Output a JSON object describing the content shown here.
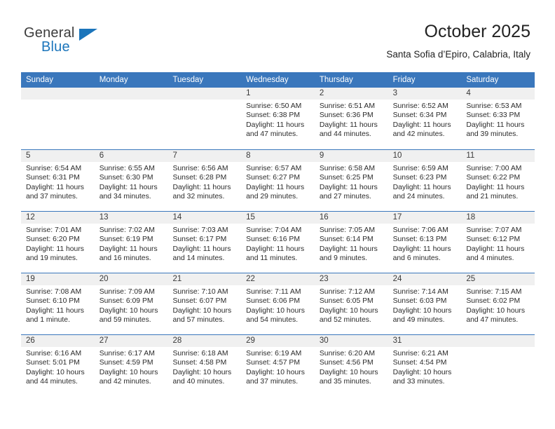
{
  "brand": {
    "name_part1": "General",
    "name_part2": "Blue"
  },
  "header": {
    "title": "October 2025",
    "subtitle": "Santa Sofia d’Epiro, Calabria, Italy"
  },
  "weekdays": [
    "Sunday",
    "Monday",
    "Tuesday",
    "Wednesday",
    "Thursday",
    "Friday",
    "Saturday"
  ],
  "colors": {
    "header_blue": "#3a77bc",
    "brand_blue": "#1b75bb",
    "daynum_band": "#f0f0f0",
    "text": "#2b2b2b"
  },
  "weeks": [
    [
      {
        "day": "",
        "lines": []
      },
      {
        "day": "",
        "lines": []
      },
      {
        "day": "",
        "lines": []
      },
      {
        "day": "1",
        "lines": [
          "Sunrise: 6:50 AM",
          "Sunset: 6:38 PM",
          "Daylight: 11 hours",
          "and 47 minutes."
        ]
      },
      {
        "day": "2",
        "lines": [
          "Sunrise: 6:51 AM",
          "Sunset: 6:36 PM",
          "Daylight: 11 hours",
          "and 44 minutes."
        ]
      },
      {
        "day": "3",
        "lines": [
          "Sunrise: 6:52 AM",
          "Sunset: 6:34 PM",
          "Daylight: 11 hours",
          "and 42 minutes."
        ]
      },
      {
        "day": "4",
        "lines": [
          "Sunrise: 6:53 AM",
          "Sunset: 6:33 PM",
          "Daylight: 11 hours",
          "and 39 minutes."
        ]
      }
    ],
    [
      {
        "day": "5",
        "lines": [
          "Sunrise: 6:54 AM",
          "Sunset: 6:31 PM",
          "Daylight: 11 hours",
          "and 37 minutes."
        ]
      },
      {
        "day": "6",
        "lines": [
          "Sunrise: 6:55 AM",
          "Sunset: 6:30 PM",
          "Daylight: 11 hours",
          "and 34 minutes."
        ]
      },
      {
        "day": "7",
        "lines": [
          "Sunrise: 6:56 AM",
          "Sunset: 6:28 PM",
          "Daylight: 11 hours",
          "and 32 minutes."
        ]
      },
      {
        "day": "8",
        "lines": [
          "Sunrise: 6:57 AM",
          "Sunset: 6:27 PM",
          "Daylight: 11 hours",
          "and 29 minutes."
        ]
      },
      {
        "day": "9",
        "lines": [
          "Sunrise: 6:58 AM",
          "Sunset: 6:25 PM",
          "Daylight: 11 hours",
          "and 27 minutes."
        ]
      },
      {
        "day": "10",
        "lines": [
          "Sunrise: 6:59 AM",
          "Sunset: 6:23 PM",
          "Daylight: 11 hours",
          "and 24 minutes."
        ]
      },
      {
        "day": "11",
        "lines": [
          "Sunrise: 7:00 AM",
          "Sunset: 6:22 PM",
          "Daylight: 11 hours",
          "and 21 minutes."
        ]
      }
    ],
    [
      {
        "day": "12",
        "lines": [
          "Sunrise: 7:01 AM",
          "Sunset: 6:20 PM",
          "Daylight: 11 hours",
          "and 19 minutes."
        ]
      },
      {
        "day": "13",
        "lines": [
          "Sunrise: 7:02 AM",
          "Sunset: 6:19 PM",
          "Daylight: 11 hours",
          "and 16 minutes."
        ]
      },
      {
        "day": "14",
        "lines": [
          "Sunrise: 7:03 AM",
          "Sunset: 6:17 PM",
          "Daylight: 11 hours",
          "and 14 minutes."
        ]
      },
      {
        "day": "15",
        "lines": [
          "Sunrise: 7:04 AM",
          "Sunset: 6:16 PM",
          "Daylight: 11 hours",
          "and 11 minutes."
        ]
      },
      {
        "day": "16",
        "lines": [
          "Sunrise: 7:05 AM",
          "Sunset: 6:14 PM",
          "Daylight: 11 hours",
          "and 9 minutes."
        ]
      },
      {
        "day": "17",
        "lines": [
          "Sunrise: 7:06 AM",
          "Sunset: 6:13 PM",
          "Daylight: 11 hours",
          "and 6 minutes."
        ]
      },
      {
        "day": "18",
        "lines": [
          "Sunrise: 7:07 AM",
          "Sunset: 6:12 PM",
          "Daylight: 11 hours",
          "and 4 minutes."
        ]
      }
    ],
    [
      {
        "day": "19",
        "lines": [
          "Sunrise: 7:08 AM",
          "Sunset: 6:10 PM",
          "Daylight: 11 hours",
          "and 1 minute."
        ]
      },
      {
        "day": "20",
        "lines": [
          "Sunrise: 7:09 AM",
          "Sunset: 6:09 PM",
          "Daylight: 10 hours",
          "and 59 minutes."
        ]
      },
      {
        "day": "21",
        "lines": [
          "Sunrise: 7:10 AM",
          "Sunset: 6:07 PM",
          "Daylight: 10 hours",
          "and 57 minutes."
        ]
      },
      {
        "day": "22",
        "lines": [
          "Sunrise: 7:11 AM",
          "Sunset: 6:06 PM",
          "Daylight: 10 hours",
          "and 54 minutes."
        ]
      },
      {
        "day": "23",
        "lines": [
          "Sunrise: 7:12 AM",
          "Sunset: 6:05 PM",
          "Daylight: 10 hours",
          "and 52 minutes."
        ]
      },
      {
        "day": "24",
        "lines": [
          "Sunrise: 7:14 AM",
          "Sunset: 6:03 PM",
          "Daylight: 10 hours",
          "and 49 minutes."
        ]
      },
      {
        "day": "25",
        "lines": [
          "Sunrise: 7:15 AM",
          "Sunset: 6:02 PM",
          "Daylight: 10 hours",
          "and 47 minutes."
        ]
      }
    ],
    [
      {
        "day": "26",
        "lines": [
          "Sunrise: 6:16 AM",
          "Sunset: 5:01 PM",
          "Daylight: 10 hours",
          "and 44 minutes."
        ]
      },
      {
        "day": "27",
        "lines": [
          "Sunrise: 6:17 AM",
          "Sunset: 4:59 PM",
          "Daylight: 10 hours",
          "and 42 minutes."
        ]
      },
      {
        "day": "28",
        "lines": [
          "Sunrise: 6:18 AM",
          "Sunset: 4:58 PM",
          "Daylight: 10 hours",
          "and 40 minutes."
        ]
      },
      {
        "day": "29",
        "lines": [
          "Sunrise: 6:19 AM",
          "Sunset: 4:57 PM",
          "Daylight: 10 hours",
          "and 37 minutes."
        ]
      },
      {
        "day": "30",
        "lines": [
          "Sunrise: 6:20 AM",
          "Sunset: 4:56 PM",
          "Daylight: 10 hours",
          "and 35 minutes."
        ]
      },
      {
        "day": "31",
        "lines": [
          "Sunrise: 6:21 AM",
          "Sunset: 4:54 PM",
          "Daylight: 10 hours",
          "and 33 minutes."
        ]
      },
      {
        "day": "",
        "lines": []
      }
    ]
  ]
}
